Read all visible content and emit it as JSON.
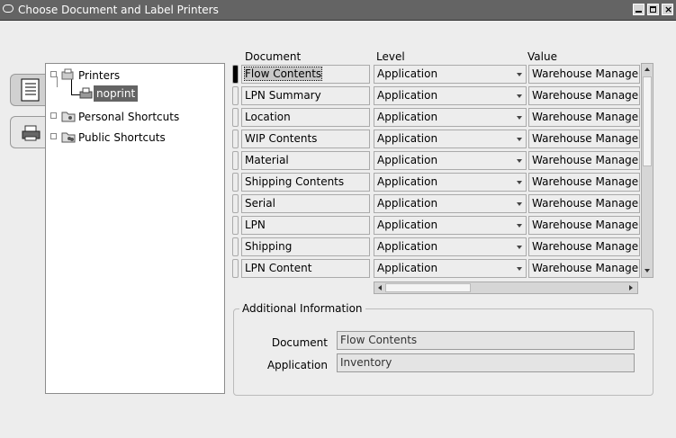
{
  "window": {
    "title": "Choose Document and Label Printers"
  },
  "tree": {
    "items": [
      {
        "label": "Printers"
      },
      {
        "label": "noprint"
      },
      {
        "label": "Personal Shortcuts"
      },
      {
        "label": "Public Shortcuts"
      }
    ]
  },
  "grid": {
    "headers": {
      "document": "Document",
      "level": "Level",
      "value": "Value"
    },
    "rows": [
      {
        "document": "Flow Contents",
        "level": "Application",
        "value": "Warehouse Manager"
      },
      {
        "document": "LPN Summary",
        "level": "Application",
        "value": "Warehouse Manager"
      },
      {
        "document": "Location",
        "level": "Application",
        "value": "Warehouse Manager"
      },
      {
        "document": "WIP Contents",
        "level": "Application",
        "value": "Warehouse Manager"
      },
      {
        "document": "Material",
        "level": "Application",
        "value": "Warehouse Manager"
      },
      {
        "document": "Shipping Contents",
        "level": "Application",
        "value": "Warehouse Manager"
      },
      {
        "document": "Serial",
        "level": "Application",
        "value": "Warehouse Manager"
      },
      {
        "document": "LPN",
        "level": "Application",
        "value": "Warehouse Manager"
      },
      {
        "document": "Shipping",
        "level": "Application",
        "value": "Warehouse Manager"
      },
      {
        "document": "LPN Content",
        "level": "Application",
        "value": "Warehouse Manager"
      }
    ]
  },
  "additional_info": {
    "title": "Additional Information",
    "document_label": "Document",
    "document_value": "Flow Contents",
    "application_label": "Application",
    "application_value": "Inventory"
  }
}
